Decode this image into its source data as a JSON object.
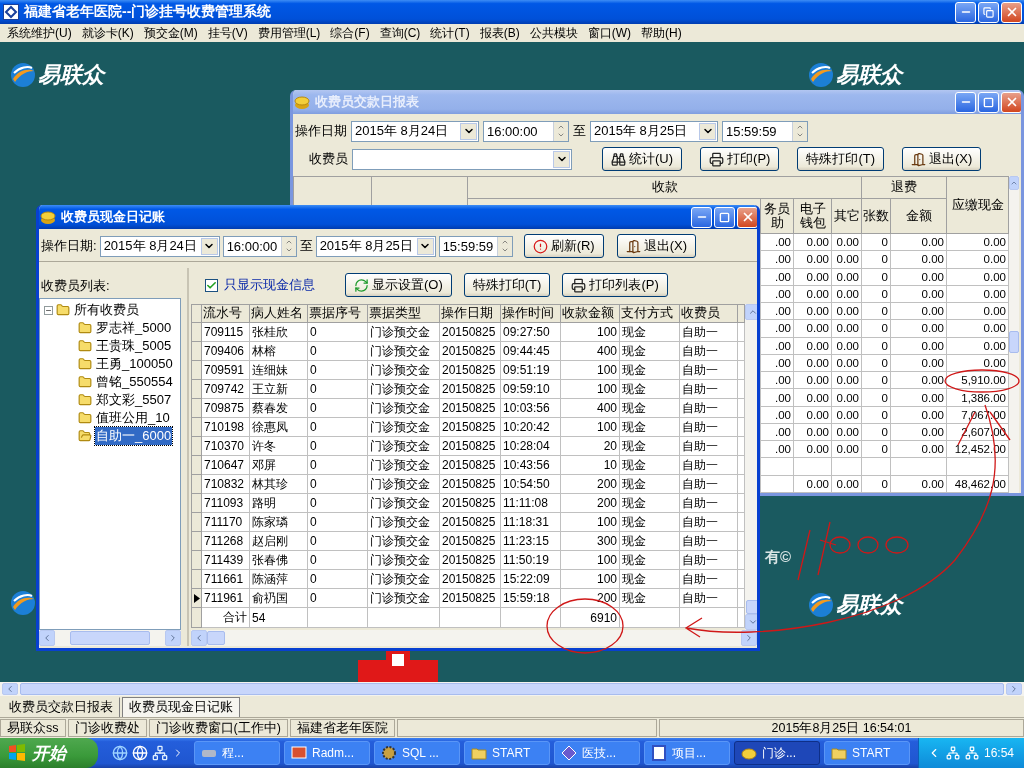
{
  "app_window": {
    "title": "福建省老年医院--门诊挂号收费管理系统"
  },
  "menu": [
    "系统维护(U)",
    "就诊卡(K)",
    "预交金(M)",
    "挂号(V)",
    "费用管理(L)",
    "综合(F)",
    "查询(C)",
    "统计(T)",
    "报表(B)",
    "公共模块",
    "窗口(W)",
    "帮助(H)"
  ],
  "desktop": {
    "logos": [
      "易联众",
      "易联众",
      "易联众"
    ],
    "footer_text": "有©"
  },
  "report_window": {
    "title": "收费员交款日报表",
    "active": false,
    "date_label": "操作日期",
    "from_date": "2015年 8月24日",
    "from_time": "16:00:00",
    "to_label": "至",
    "to_date": "2015年 8月25日",
    "to_time": "15:59:59",
    "cashier_label": "收费员",
    "buttons": [
      "统计(U)",
      "打印(P)",
      "特殊打印(T)",
      "退出(X)"
    ],
    "table": {
      "group_headers": [
        "收款",
        "退费"
      ],
      "columns": [
        "务员助",
        "电子钱包",
        "其它",
        "张数",
        "金额",
        "应缴现金"
      ],
      "rows": [
        [
          ".00",
          "0.00",
          "0.00",
          "0",
          "0.00",
          "0.00"
        ],
        [
          ".00",
          "0.00",
          "0.00",
          "0",
          "0.00",
          "0.00"
        ],
        [
          ".00",
          "0.00",
          "0.00",
          "0",
          "0.00",
          "0.00"
        ],
        [
          ".00",
          "0.00",
          "0.00",
          "0",
          "0.00",
          "0.00"
        ],
        [
          ".00",
          "0.00",
          "0.00",
          "0",
          "0.00",
          "0.00"
        ],
        [
          ".00",
          "0.00",
          "0.00",
          "0",
          "0.00",
          "0.00"
        ],
        [
          ".00",
          "0.00",
          "0.00",
          "0",
          "0.00",
          "0.00"
        ],
        [
          ".00",
          "0.00",
          "0.00",
          "0",
          "0.00",
          "0.00"
        ],
        [
          ".00",
          "0.00",
          "0.00",
          "0",
          "0.00",
          "5,910.00"
        ],
        [
          ".00",
          "0.00",
          "0.00",
          "0",
          "0.00",
          "1,386.00"
        ],
        [
          ".00",
          "0.00",
          "0.00",
          "0",
          "0.00",
          "7,067.00"
        ],
        [
          ".00",
          "0.00",
          "0.00",
          "0",
          "0.00",
          "2,607.00"
        ],
        [
          ".00",
          "0.00",
          "0.00",
          "0",
          "0.00",
          "12,452.00"
        ]
      ],
      "total": [
        "0.00",
        "0.00",
        "0",
        "0.00",
        "48,462.00"
      ]
    }
  },
  "cash_window": {
    "title": "收费员现金日记账",
    "active": true,
    "date_label": "操作日期:",
    "from_date": "2015年 8月24日",
    "from_time": "16:00:00",
    "to_label": "至",
    "to_date": "2015年 8月25日",
    "to_time": "15:59:59",
    "buttons": [
      "刷新(R)",
      "退出(X)"
    ],
    "tree_label": "收费员列表:",
    "tree": {
      "label": "所有收费员",
      "expanded": true,
      "children": [
        {
          "label": "罗志祥_5000",
          "selected": false
        },
        {
          "label": "王贵珠_5005",
          "selected": false
        },
        {
          "label": "王勇_100050",
          "selected": false
        },
        {
          "label": "曾铭_550554",
          "selected": false
        },
        {
          "label": "郑文彩_5507",
          "selected": false
        },
        {
          "label": "值班公用_10",
          "selected": false
        },
        {
          "label": "自助一_6000",
          "selected": true
        }
      ]
    },
    "cash_only": {
      "label": "只显示现金信息",
      "checked": true
    },
    "grid_buttons": [
      "显示设置(O)",
      "特殊打印(T)",
      "打印列表(P)"
    ],
    "table": {
      "columns": [
        "流水号",
        "病人姓名",
        "票据序号",
        "票据类型",
        "操作日期",
        "操作时间",
        "收款金额",
        "支付方式",
        "收费员"
      ],
      "rows": [
        {
          "cells": [
            "709115",
            "张桂欣",
            "0",
            "门诊预交金",
            "20150825",
            "09:27:50",
            "100",
            "现金",
            "自助一"
          ],
          "selected": false
        },
        {
          "cells": [
            "709406",
            "林榕",
            "0",
            "门诊预交金",
            "20150825",
            "09:44:45",
            "400",
            "现金",
            "自助一"
          ],
          "selected": false
        },
        {
          "cells": [
            "709591",
            "连细妹",
            "0",
            "门诊预交金",
            "20150825",
            "09:51:19",
            "100",
            "现金",
            "自助一"
          ],
          "selected": false
        },
        {
          "cells": [
            "709742",
            "王立新",
            "0",
            "门诊预交金",
            "20150825",
            "09:59:10",
            "100",
            "现金",
            "自助一"
          ],
          "selected": false
        },
        {
          "cells": [
            "709875",
            "蔡春发",
            "0",
            "门诊预交金",
            "20150825",
            "10:03:56",
            "400",
            "现金",
            "自助一"
          ],
          "selected": false
        },
        {
          "cells": [
            "710198",
            "徐惠凤",
            "0",
            "门诊预交金",
            "20150825",
            "10:20:42",
            "100",
            "现金",
            "自助一"
          ],
          "selected": false
        },
        {
          "cells": [
            "710370",
            "许冬",
            "0",
            "门诊预交金",
            "20150825",
            "10:28:04",
            "20",
            "现金",
            "自助一"
          ],
          "selected": false
        },
        {
          "cells": [
            "710647",
            "邓屏",
            "0",
            "门诊预交金",
            "20150825",
            "10:43:56",
            "10",
            "现金",
            "自助一"
          ],
          "selected": false
        },
        {
          "cells": [
            "710832",
            "林其珍",
            "0",
            "门诊预交金",
            "20150825",
            "10:54:50",
            "200",
            "现金",
            "自助一"
          ],
          "selected": false
        },
        {
          "cells": [
            "711093",
            "路明",
            "0",
            "门诊预交金",
            "20150825",
            "11:11:08",
            "200",
            "现金",
            "自助一"
          ],
          "selected": false
        },
        {
          "cells": [
            "711170",
            "陈家璘",
            "0",
            "门诊预交金",
            "20150825",
            "11:18:31",
            "100",
            "现金",
            "自助一"
          ],
          "selected": false
        },
        {
          "cells": [
            "711268",
            "赵启刚",
            "0",
            "门诊预交金",
            "20150825",
            "11:23:15",
            "300",
            "现金",
            "自助一"
          ],
          "selected": false
        },
        {
          "cells": [
            "711439",
            "张春佛",
            "0",
            "门诊预交金",
            "20150825",
            "11:50:19",
            "100",
            "现金",
            "自助一"
          ],
          "selected": false
        },
        {
          "cells": [
            "711661",
            "陈涵萍",
            "0",
            "门诊预交金",
            "20150825",
            "15:22:09",
            "100",
            "现金",
            "自助一"
          ],
          "selected": false
        },
        {
          "cells": [
            "711961",
            "俞礽国",
            "0",
            "门诊预交金",
            "20150825",
            "15:59:18",
            "200",
            "现金",
            "自助一"
          ],
          "selected": true
        }
      ],
      "total": {
        "label": "合计",
        "count": "54",
        "amount": "6910"
      }
    }
  },
  "mdi_tabs": [
    {
      "label": "收费员交款日报表",
      "selected": false
    },
    {
      "label": "收费员现金日记账",
      "selected": true
    }
  ],
  "status_bar": {
    "panels": [
      "易联众ss",
      "门诊收费处",
      "门诊收费窗口(工作中)",
      "福建省老年医院"
    ],
    "datetime": "2015年8月25日 16:54:01"
  },
  "taskbar": {
    "start": "开始",
    "tasks": [
      {
        "label": "程...",
        "selected": false
      },
      {
        "label": "Radm...",
        "selected": false
      },
      {
        "label": "SQL ...",
        "selected": false
      },
      {
        "label": "START",
        "selected": false
      },
      {
        "label": "医技...",
        "selected": false
      },
      {
        "label": "项目...",
        "selected": false
      },
      {
        "label": "门诊...",
        "selected": true
      },
      {
        "label": "START",
        "selected": false
      }
    ],
    "clock": "16:54"
  }
}
